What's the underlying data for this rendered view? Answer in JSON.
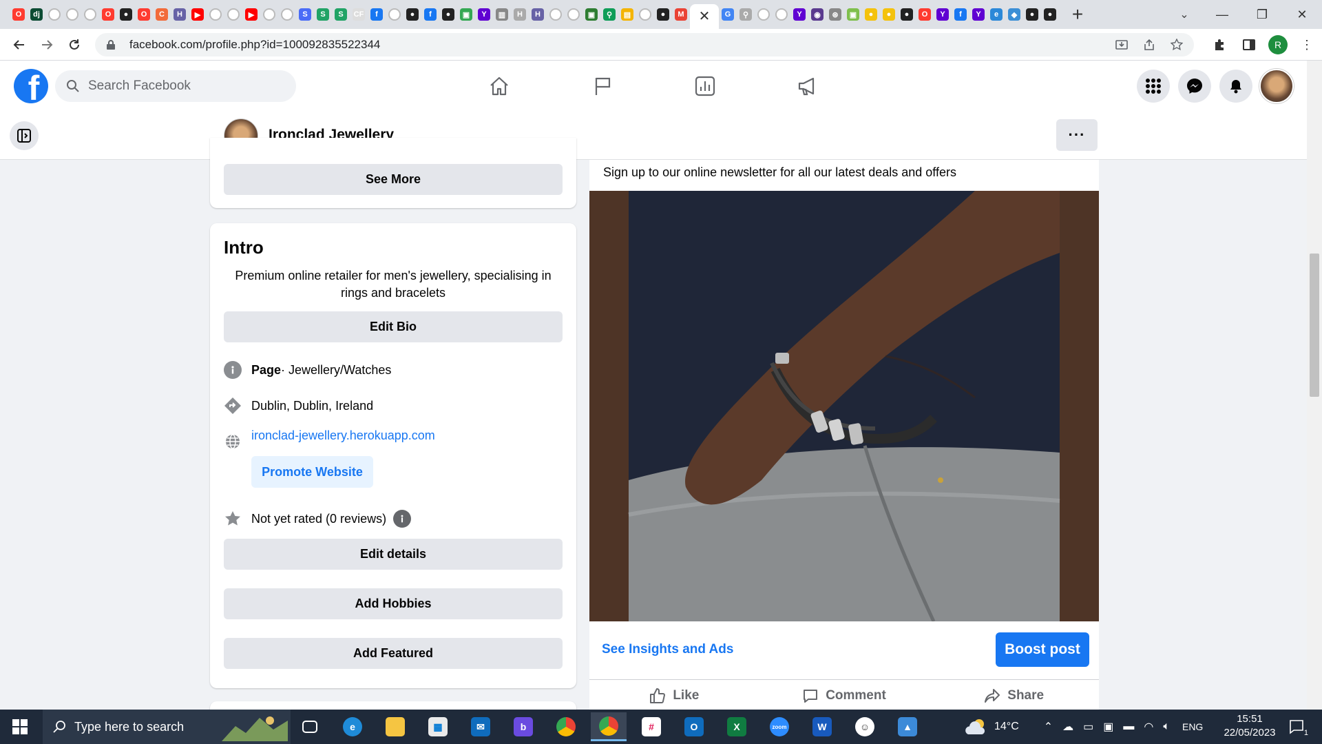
{
  "browser": {
    "tab_favicons": [
      {
        "name": "opera-tab-icon",
        "color": "#ff3b30",
        "glyph": "O"
      },
      {
        "name": "django-tab-icon",
        "color": "#0c4b33",
        "glyph": "dj"
      },
      {
        "name": "github-tab-icon",
        "color": "#d0d0d0",
        "glyph": ""
      },
      {
        "name": "github-tab-icon",
        "color": "#d0d0d0",
        "glyph": ""
      },
      {
        "name": "github-tab-icon",
        "color": "#d0d0d0",
        "glyph": ""
      },
      {
        "name": "opera-tab-icon",
        "color": "#ff3b30",
        "glyph": "O"
      },
      {
        "name": "circle-tab-icon",
        "color": "#222222",
        "glyph": "●"
      },
      {
        "name": "opera-tab-icon",
        "color": "#ff3b30",
        "glyph": "O"
      },
      {
        "name": "refresh-tab-icon",
        "color": "#f26b3a",
        "glyph": "C"
      },
      {
        "name": "heroku-tab-icon",
        "color": "#6762a6",
        "glyph": "H"
      },
      {
        "name": "youtube-tab-icon",
        "color": "#ff0000",
        "glyph": "▶"
      },
      {
        "name": "github-tab-icon",
        "color": "#d0d0d0",
        "glyph": ""
      },
      {
        "name": "github-tab-icon",
        "color": "#d0d0d0",
        "glyph": ""
      },
      {
        "name": "youtube-tab-icon",
        "color": "#ff0000",
        "glyph": "▶"
      },
      {
        "name": "github-tab-icon",
        "color": "#d0d0d0",
        "glyph": ""
      },
      {
        "name": "github-tab-icon",
        "color": "#d0d0d0",
        "glyph": ""
      },
      {
        "name": "s-tab-icon",
        "color": "#4a6cf7",
        "glyph": "S"
      },
      {
        "name": "s-tab-icon",
        "color": "#21a366",
        "glyph": "S"
      },
      {
        "name": "s-tab-icon",
        "color": "#21a366",
        "glyph": "S"
      },
      {
        "name": "cf-tab-icon",
        "color": "#dddddd",
        "glyph": "CF"
      },
      {
        "name": "facebook-tab-icon",
        "color": "#1877f2",
        "glyph": "f"
      },
      {
        "name": "github-tab-icon",
        "color": "#d0d0d0",
        "glyph": ""
      },
      {
        "name": "circle-tab-icon",
        "color": "#222222",
        "glyph": "●"
      },
      {
        "name": "facebook-tab-icon",
        "color": "#1877f2",
        "glyph": "f"
      },
      {
        "name": "circle-tab-icon",
        "color": "#222222",
        "glyph": "●"
      },
      {
        "name": "green-tab-icon",
        "color": "#34a853",
        "glyph": "▣"
      },
      {
        "name": "yahoo-tab-icon",
        "color": "#6001d2",
        "glyph": "Y"
      },
      {
        "name": "chart-tab-icon",
        "color": "#888888",
        "glyph": "▥"
      },
      {
        "name": "heroku-tab-icon",
        "color": "#aaaaaa",
        "glyph": "H"
      },
      {
        "name": "heroku-tab-icon",
        "color": "#6762a6",
        "glyph": "H"
      },
      {
        "name": "github-tab-icon",
        "color": "#d0d0d0",
        "glyph": ""
      },
      {
        "name": "github-tab-icon",
        "color": "#d0d0d0",
        "glyph": ""
      },
      {
        "name": "green-tab-icon",
        "color": "#2e7d32",
        "glyph": "▣"
      },
      {
        "name": "pin-tab-icon",
        "color": "#0f9d58",
        "glyph": "⚲"
      },
      {
        "name": "doc-tab-icon",
        "color": "#f4b400",
        "glyph": "▤"
      },
      {
        "name": "github-tab-icon",
        "color": "#d0d0d0",
        "glyph": ""
      },
      {
        "name": "circle-tab-icon",
        "color": "#222222",
        "glyph": "●"
      },
      {
        "name": "gmail-tab-icon",
        "color": "#ea4335",
        "glyph": "M"
      }
    ],
    "active_tab_close": "✕",
    "tab_favicons_after": [
      {
        "name": "google-tab-icon",
        "color": "#4285f4",
        "glyph": "G"
      },
      {
        "name": "pin-tab-icon",
        "color": "#aaaaaa",
        "glyph": "⚲"
      },
      {
        "name": "github-tab-icon",
        "color": "#d0d0d0",
        "glyph": ""
      },
      {
        "name": "github-tab-icon",
        "color": "#d0d0d0",
        "glyph": ""
      },
      {
        "name": "yahoo-tab-icon",
        "color": "#6001d2",
        "glyph": "Y"
      },
      {
        "name": "purple-tab-icon",
        "color": "#5b3a8f",
        "glyph": "◉"
      },
      {
        "name": "openai-tab-icon",
        "color": "#888888",
        "glyph": "⊛"
      },
      {
        "name": "green-tab-icon",
        "color": "#7fbf4d",
        "glyph": "▣"
      },
      {
        "name": "coin-tab-icon",
        "color": "#f4c20d",
        "glyph": "●"
      },
      {
        "name": "coin-tab-icon",
        "color": "#f4c20d",
        "glyph": "●"
      },
      {
        "name": "circle-tab-icon",
        "color": "#222222",
        "glyph": "●"
      },
      {
        "name": "opera-tab-icon",
        "color": "#ff3b30",
        "glyph": "O"
      },
      {
        "name": "yahoo-tab-icon",
        "color": "#6001d2",
        "glyph": "Y"
      },
      {
        "name": "facebook-tab-icon",
        "color": "#1877f2",
        "glyph": "f"
      },
      {
        "name": "yahoo-tab-icon",
        "color": "#6001d2",
        "glyph": "Y"
      },
      {
        "name": "edge-tab-icon",
        "color": "#2b88d8",
        "glyph": "e"
      },
      {
        "name": "gradient-tab-icon",
        "color": "#3b8fd6",
        "glyph": "◆"
      },
      {
        "name": "circle-tab-icon",
        "color": "#222222",
        "glyph": "●"
      },
      {
        "name": "circle-tab-icon",
        "color": "#222222",
        "glyph": "●"
      }
    ],
    "new_tab": "+",
    "url": "facebook.com/profile.php?id=100092835522344",
    "profile_initial": "R"
  },
  "fb": {
    "search_placeholder": "Search Facebook"
  },
  "page_header": {
    "name": "Ironclad Jewellery",
    "more": "···"
  },
  "left": {
    "see_more": "See More",
    "intro_title": "Intro",
    "bio": "Premium online retailer for men's jewellery, specialising in rings and bracelets",
    "edit_bio": "Edit Bio",
    "category_strong": "Page",
    "category_rest": " · Jewellery/Watches",
    "location": "Dublin, Dublin, Ireland",
    "website": "ironclad-jewellery.herokuapp.com",
    "promote_website": "Promote Website",
    "rating": "Not yet rated (0 reviews)",
    "edit_details": "Edit details",
    "add_hobbies": "Add Hobbies",
    "add_featured": "Add Featured"
  },
  "post": {
    "text": "Sign up to our online newsletter for all our latest deals and offers",
    "insights": "See Insights and Ads",
    "boost": "Boost post",
    "like": "Like",
    "comment": "Comment",
    "share": "Share"
  },
  "taskbar": {
    "search_placeholder": "Type here to search",
    "temperature": "14°C",
    "language": "ENG",
    "time": "15:51",
    "date": "22/05/2023",
    "notification_count": "1"
  }
}
